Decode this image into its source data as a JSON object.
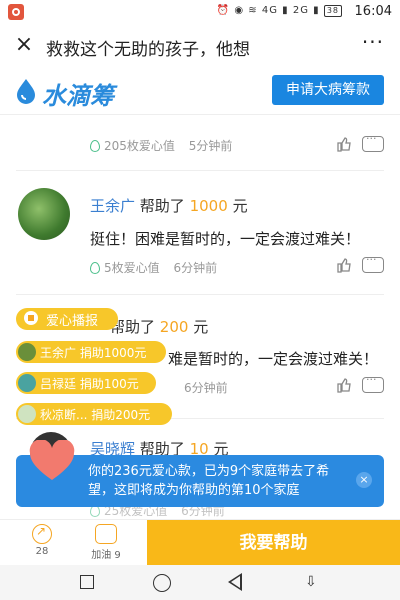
{
  "status_bar": {
    "time": "16:04",
    "icons": "⏰ ◉ ≋ 4G ▮ 2G ▮",
    "battery": "38"
  },
  "title_bar": {
    "title": "救救这个无助的孩子，他想",
    "close_icon": "×",
    "more_icon": "···"
  },
  "brand": {
    "name": "水滴筹",
    "apply_button": "申请大病筹款"
  },
  "donations": [
    {
      "love_points": "205枚爱心值",
      "time_ago": "5分钟前"
    },
    {
      "name": "王余广",
      "helped": "帮助了",
      "amount": "1000",
      "unit": "元",
      "message": "挺住！困难是暂时的，一定会渡过难关！",
      "love_points": "5枚爱心值",
      "time_ago": "6分钟前"
    },
    {
      "helped": "帮助了",
      "amount": "200",
      "unit": "元",
      "message": "难是暂时的，一定会渡过难关！",
      "time_ago": "6分钟前"
    },
    {
      "name": "吴晓辉",
      "helped": "帮助了",
      "amount": "10",
      "unit": "元",
      "love_points": "25枚爱心值",
      "time_ago": "6分钟前"
    }
  ],
  "broadcast": {
    "title": "爱心播报",
    "items": [
      {
        "text": "王余广  捐助1000元"
      },
      {
        "text": "吕禄廷  捐助100元"
      },
      {
        "text": "秋凉断...  捐助200元"
      }
    ]
  },
  "notice": {
    "text": "你的236元爱心款，已为9个家庭带去了希望，这即将成为你帮助的第10个家庭",
    "close_icon": "×"
  },
  "bottom_bar": {
    "share_count": "28",
    "cheer_label": "加油 9",
    "help_button": "我要帮助"
  }
}
